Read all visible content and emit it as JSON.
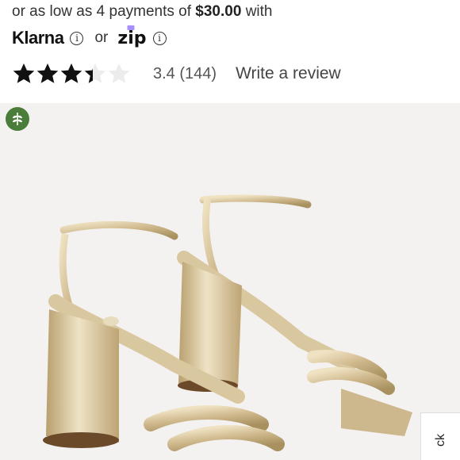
{
  "payment": {
    "prefix": "or as low as 4 payments of",
    "amount": "$30.00",
    "suffix": "with",
    "klarna": "Klarna",
    "info_glyph": "i",
    "or_text": "or",
    "zip_letters": [
      "z",
      "i",
      "p"
    ]
  },
  "rating": {
    "value": 3.4,
    "max": 5,
    "text": "3.4 (144)",
    "write_review": "Write a review"
  },
  "product_image": {
    "alt_description": "gold strappy block heel sandals",
    "colors": {
      "background": "#f4f2f0",
      "metallic": "#d6c29a",
      "badge": "#4b7d3a"
    }
  },
  "side_tab": {
    "label": "ck"
  },
  "icons": [
    "info-icon",
    "star-icon",
    "leaf-icon"
  ]
}
